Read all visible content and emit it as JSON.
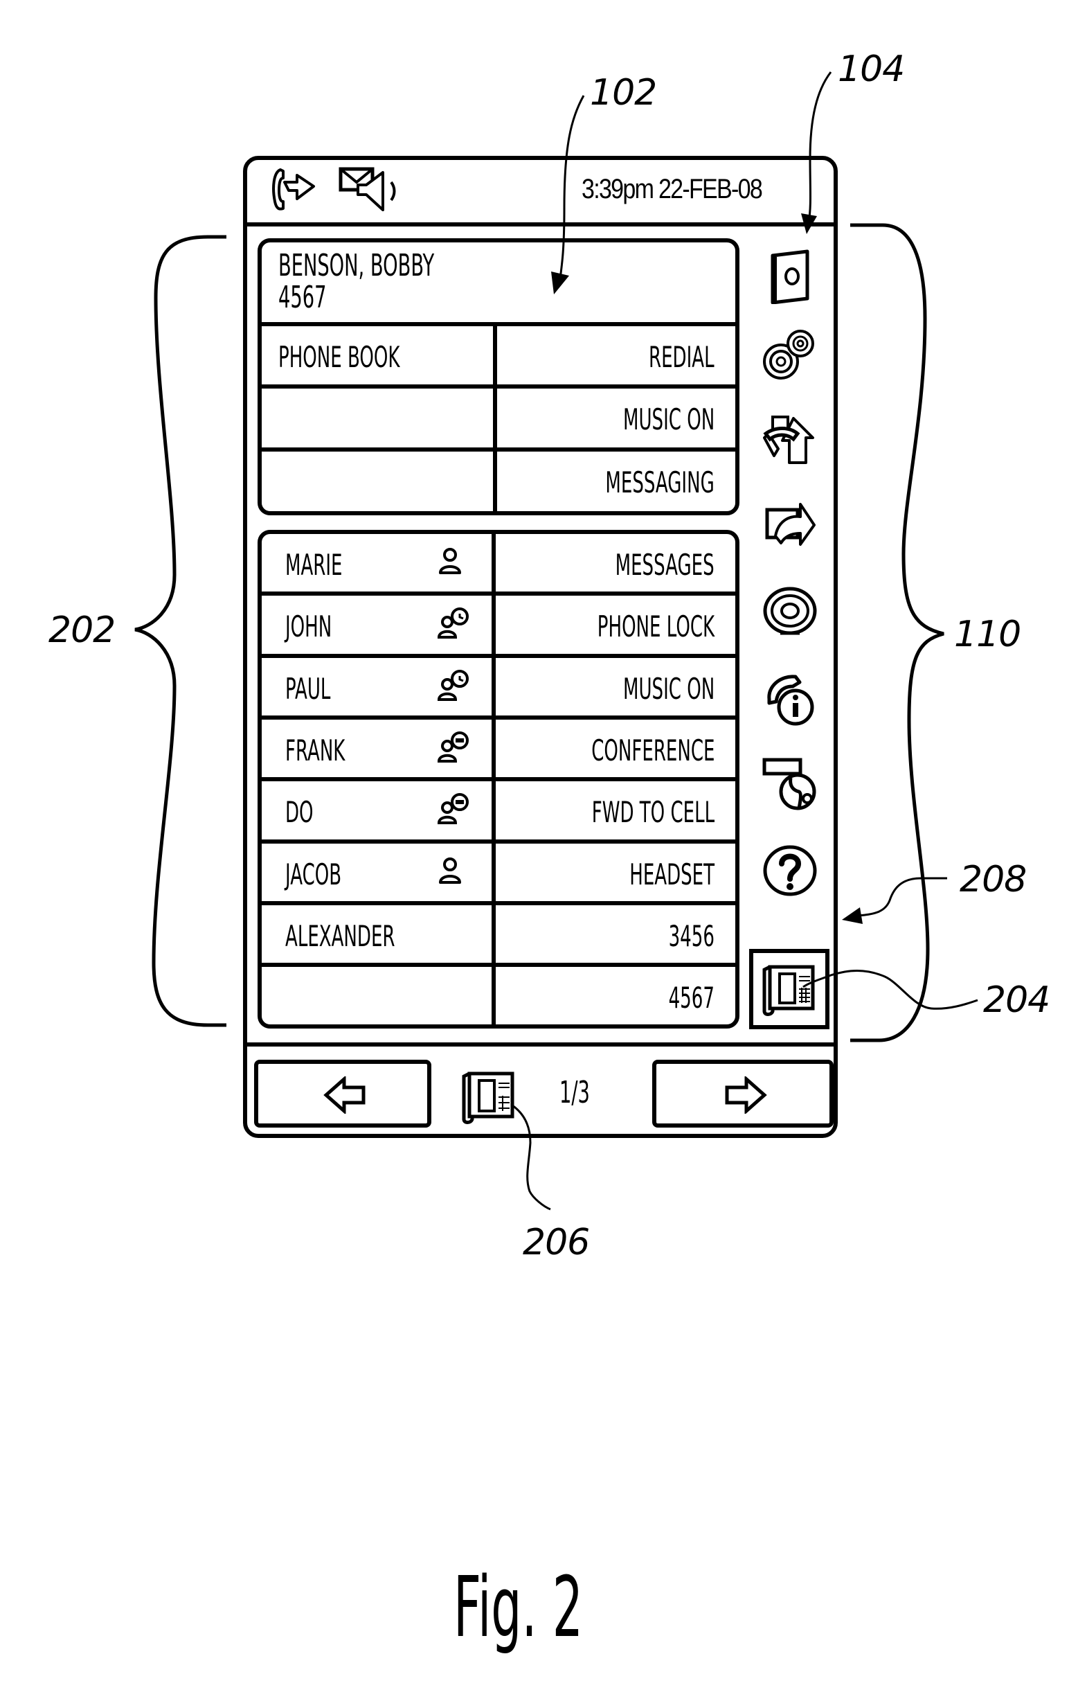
{
  "status_bar": {
    "icons": [
      "call-forward-icon",
      "voicemail-icon"
    ],
    "datetime": "3:39pm 22-FEB-08"
  },
  "active_call": {
    "name": "BENSON, BOBBY",
    "number": "4567"
  },
  "top_grid": {
    "rows": [
      {
        "left": "PHONE BOOK",
        "right": "REDIAL"
      },
      {
        "left": "",
        "right": "MUSIC ON"
      },
      {
        "left": "",
        "right": "MESSAGING"
      }
    ]
  },
  "bottom_grid": {
    "rows": [
      {
        "left": "MARIE",
        "presence": "person-icon",
        "right": "MESSAGES"
      },
      {
        "left": "JOHN",
        "presence": "person-clock-icon",
        "right": "PHONE LOCK"
      },
      {
        "left": "PAUL",
        "presence": "person-clock-icon",
        "right": "MUSIC ON"
      },
      {
        "left": "FRANK",
        "presence": "person-busy-icon",
        "right": "CONFERENCE"
      },
      {
        "left": "DO",
        "presence": "person-busy-icon",
        "right": "FWD TO CELL"
      },
      {
        "left": "JACOB",
        "presence": "person-icon",
        "right": "HEADSET"
      },
      {
        "left": "ALEXANDER",
        "presence": "",
        "right": "3456"
      },
      {
        "left": "",
        "presence": "",
        "right": "4567"
      }
    ]
  },
  "sidebar": {
    "icons": [
      "speaker-icon",
      "disc-rings-icon",
      "call-transfer-icon",
      "call-forward-arrow-icon",
      "ringer-icon",
      "call-info-icon",
      "directory-globe-icon",
      "help-icon"
    ],
    "line_button_icon": "desk-phone-icon"
  },
  "nav": {
    "back_icon": "arrow-left-icon",
    "forward_icon": "arrow-right-icon",
    "line_icon": "desk-phone-icon",
    "page_indicator": "1/3"
  },
  "reference_labels": {
    "r102": "102",
    "r104": "104",
    "r202": "202",
    "r110": "110",
    "r208": "208",
    "r204": "204",
    "r206": "206"
  },
  "figure_caption": "Fig. 2"
}
